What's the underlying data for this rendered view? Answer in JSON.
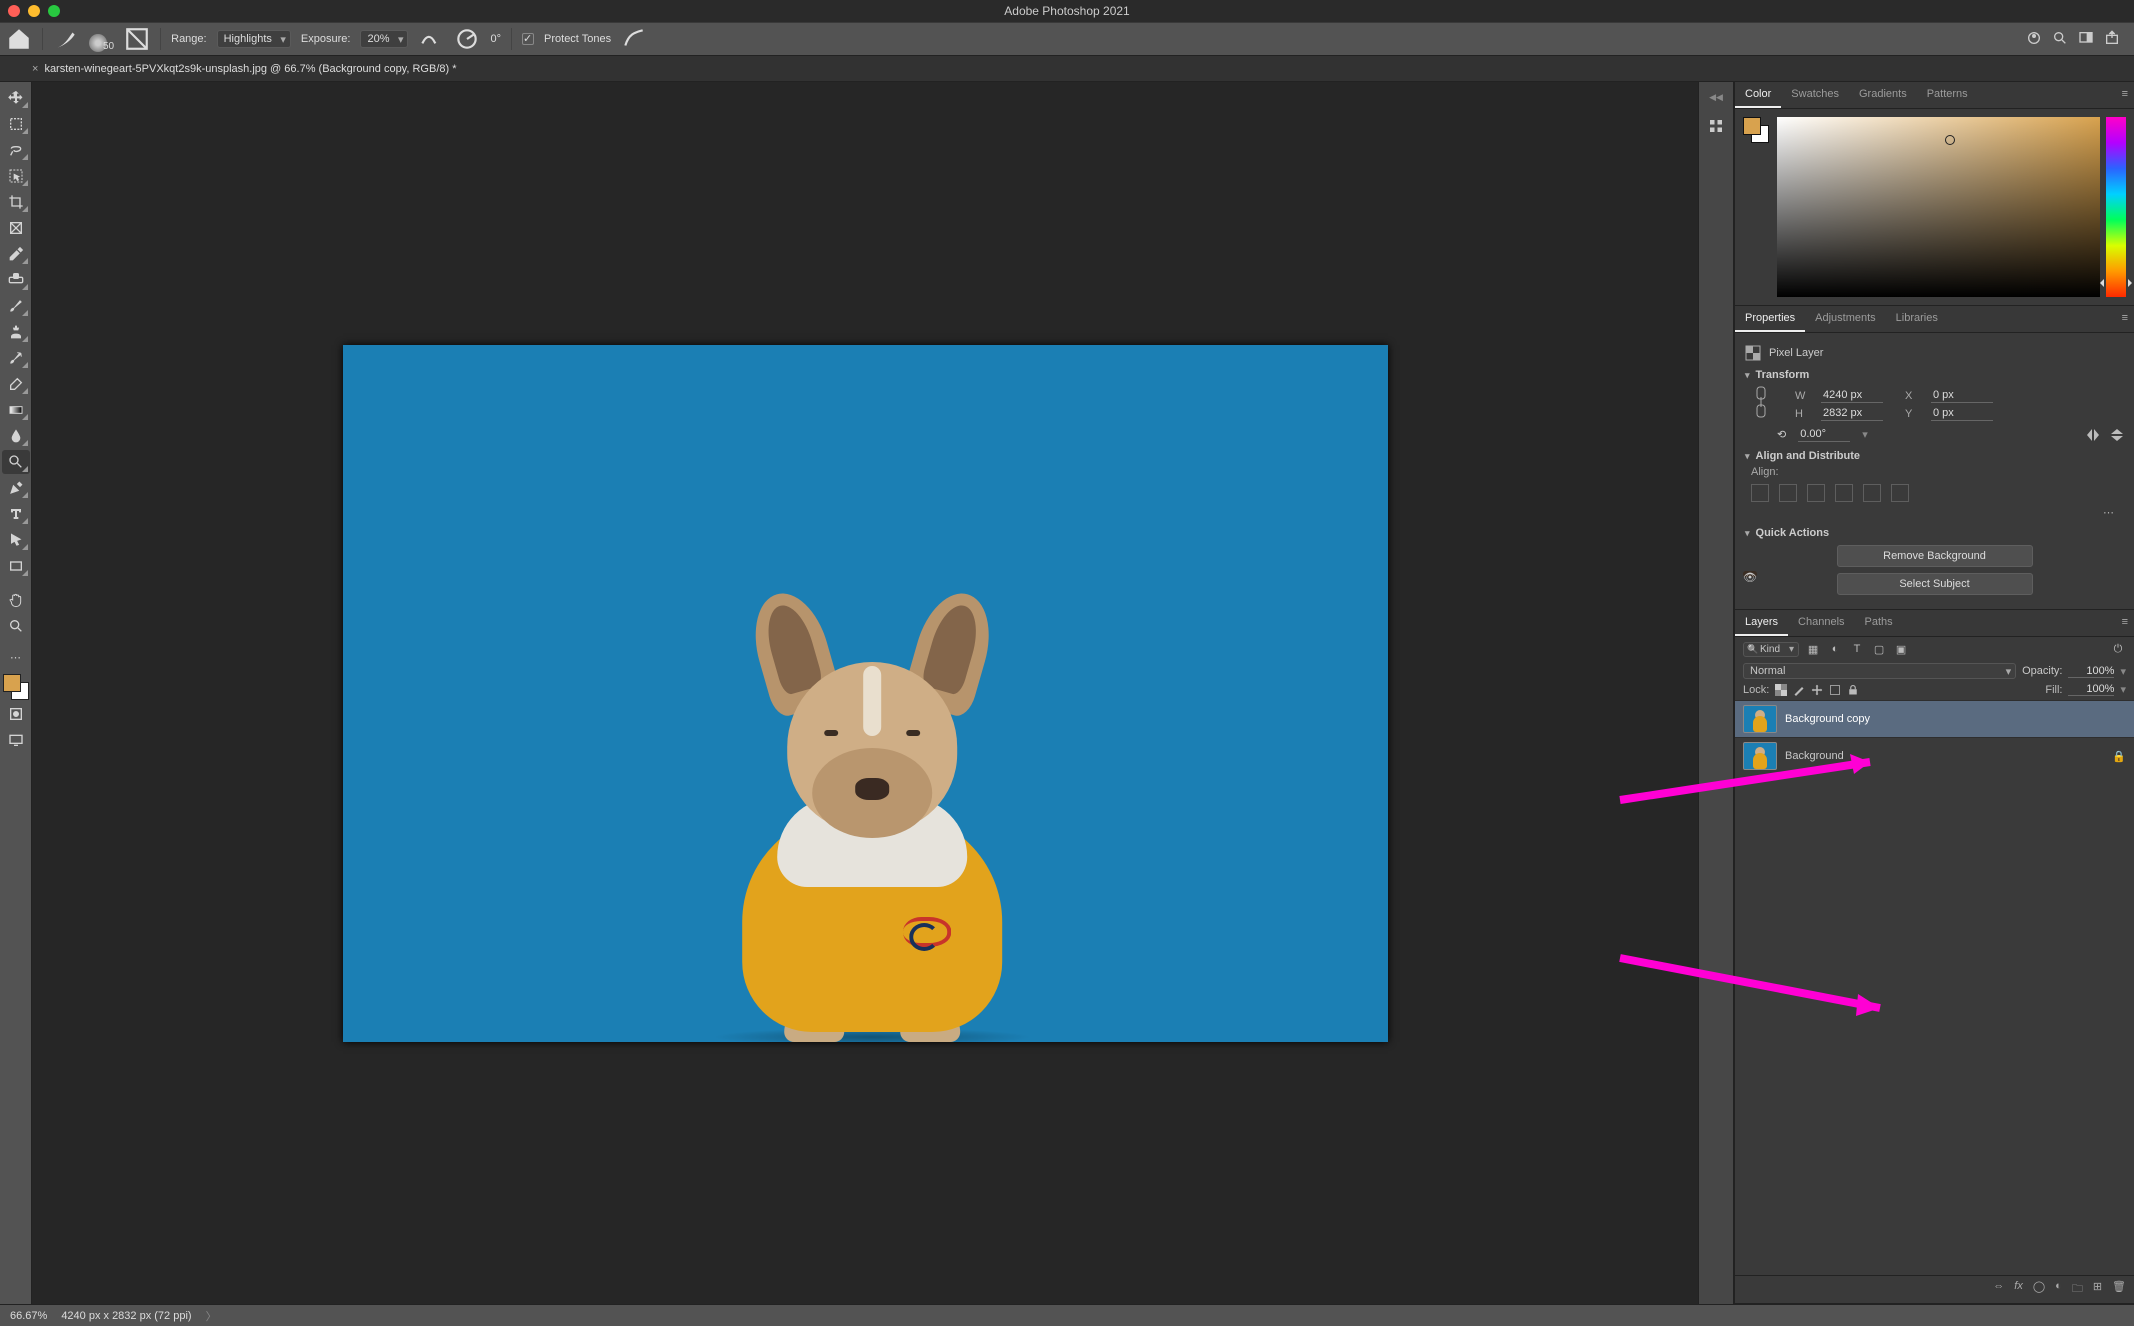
{
  "app_title": "Adobe Photoshop 2021",
  "options_bar": {
    "brush_size": "50",
    "range_label": "Range:",
    "range_value": "Highlights",
    "exposure_label": "Exposure:",
    "exposure_value": "20%",
    "angle_value": "0°",
    "protect_tones": "Protect Tones"
  },
  "document_tab": "karsten-winegeart-5PVXkqt2s9k-unsplash.jpg @ 66.7% (Background copy, RGB/8) *",
  "status": {
    "zoom": "66.67%",
    "dims": "4240 px x 2832 px (72 ppi)"
  },
  "color_panel": {
    "tabs": [
      "Color",
      "Swatches",
      "Gradients",
      "Patterns"
    ]
  },
  "properties": {
    "tabs": [
      "Properties",
      "Adjustments",
      "Libraries"
    ],
    "kind": "Pixel Layer",
    "transform_label": "Transform",
    "W": "4240 px",
    "H": "2832 px",
    "X": "0 px",
    "Y": "0 px",
    "angle": "0.00°",
    "align_label": "Align and Distribute",
    "align_sub": "Align:",
    "quick_actions_label": "Quick Actions",
    "remove_bg": "Remove Background",
    "select_subject": "Select Subject"
  },
  "layers": {
    "tabs": [
      "Layers",
      "Channels",
      "Paths"
    ],
    "kind": "Kind",
    "blend_label": "Normal",
    "opacity_label": "Opacity:",
    "opacity_value": "100%",
    "fill_label": "Fill:",
    "fill_value": "100%",
    "lock_label": "Lock:",
    "items": [
      {
        "name": "Background copy",
        "visible": false,
        "locked": false,
        "selected": true
      },
      {
        "name": "Background",
        "visible": true,
        "locked": true,
        "selected": false
      }
    ]
  },
  "tool_names": [
    "move",
    "marquee",
    "lasso",
    "object-select",
    "crop",
    "frame",
    "eyedropper",
    "healing",
    "brush",
    "clone",
    "history-brush",
    "eraser",
    "gradient",
    "blur",
    "dodge",
    "pen",
    "type",
    "path-select",
    "rectangle",
    "hand",
    "zoom"
  ]
}
